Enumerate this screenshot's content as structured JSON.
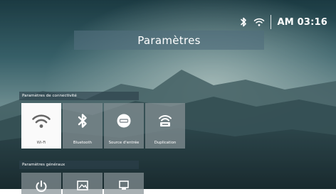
{
  "status_bar": {
    "bluetooth_icon": "bluetooth-icon",
    "wifi_icon": "wifi-icon",
    "time": "AM 03:16"
  },
  "header": {
    "title": "Paramètres"
  },
  "connectivity": {
    "section_label": "Paramètres de connectivité",
    "items": [
      {
        "label": "Wi-Fi",
        "icon": "wifi-icon",
        "selected": true
      },
      {
        "label": "Bluetooth",
        "icon": "bluetooth-icon",
        "selected": false
      },
      {
        "label": "Source d'entrée",
        "icon": "input-source-icon",
        "selected": false
      },
      {
        "label": "Duplication",
        "icon": "screen-mirroring-icon",
        "selected": false
      }
    ]
  },
  "general": {
    "section_label": "Paramètres généraux",
    "items": [
      {
        "icon": "power-icon"
      },
      {
        "icon": "picture-icon"
      },
      {
        "icon": "display-icon"
      }
    ]
  }
}
